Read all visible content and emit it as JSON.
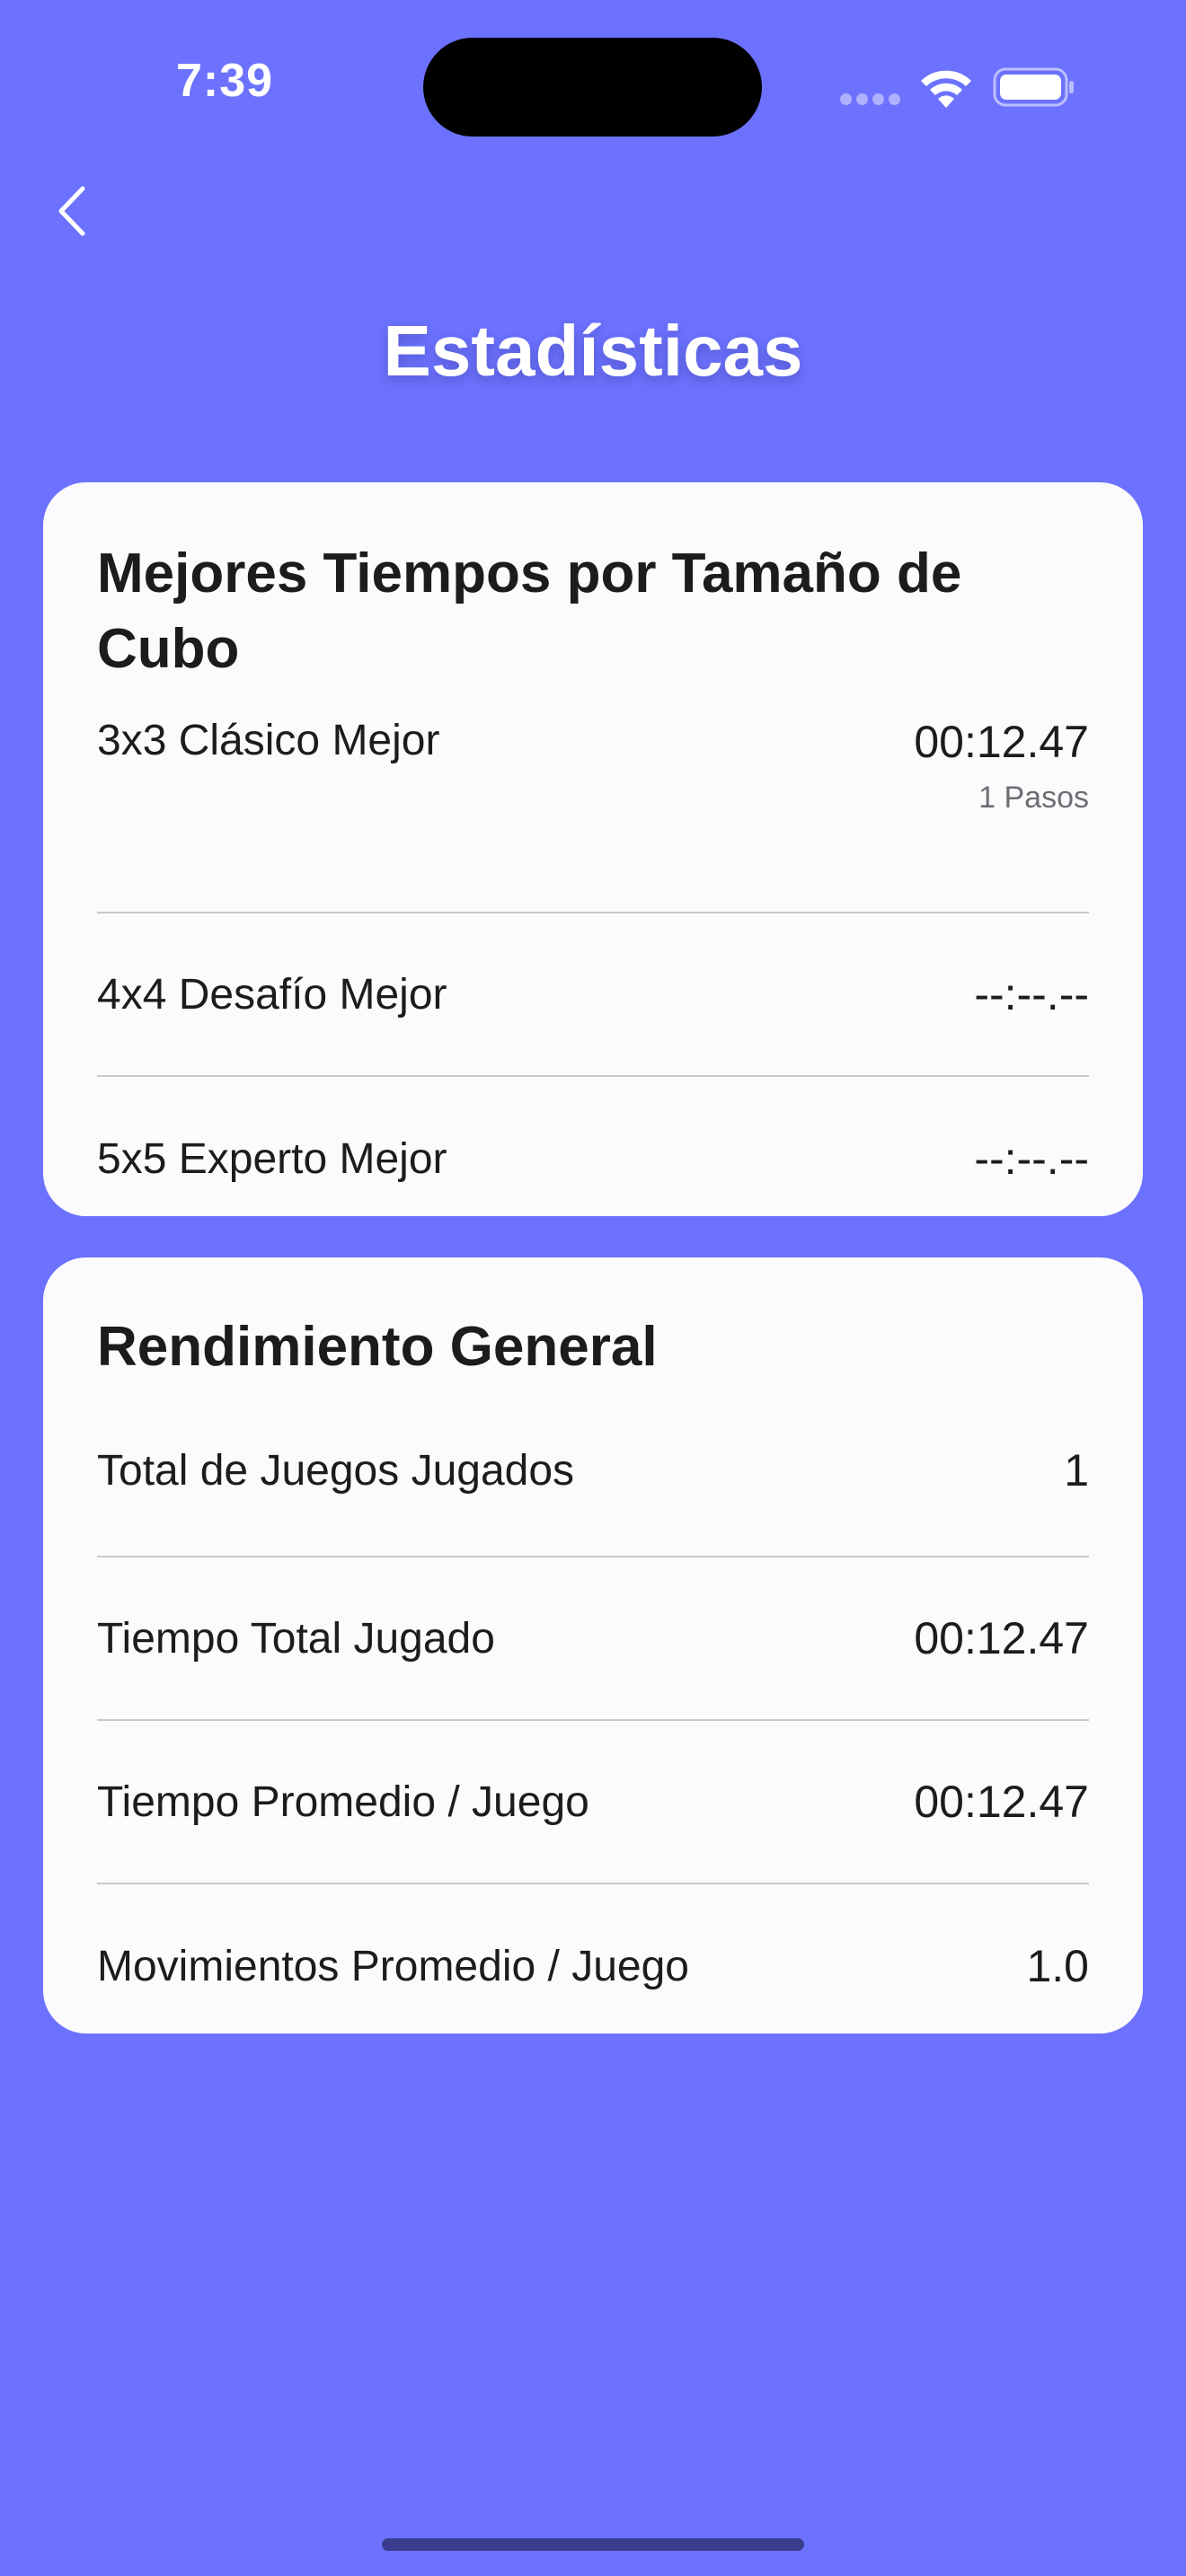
{
  "status_bar": {
    "time": "7:39"
  },
  "header": {
    "title": "Estadísticas"
  },
  "best_times": {
    "title": "Mejores Tiempos por Tamaño de Cubo",
    "rows": [
      {
        "label": "3x3 Clásico Mejor",
        "value": "00:12.47",
        "steps": "1 Pasos"
      },
      {
        "label": "4x4 Desafío Mejor",
        "value": "--:--.--"
      },
      {
        "label": "5x5 Experto Mejor",
        "value": "--:--.--"
      }
    ]
  },
  "general": {
    "title": "Rendimiento General",
    "rows": [
      {
        "label": "Total de Juegos Jugados",
        "value": "1"
      },
      {
        "label": "Tiempo Total Jugado",
        "value": "00:12.47"
      },
      {
        "label": "Tiempo Promedio / Juego",
        "value": "00:12.47"
      },
      {
        "label": "Movimientos Promedio / Juego",
        "value": "1.0"
      }
    ]
  },
  "colors": {
    "background": "#6c72fe",
    "card": "#fbfbfd",
    "text": "#1c1c1e",
    "divider": "#c7c7cc"
  },
  "icons": {
    "back": "chevron-left-icon",
    "wifi": "wifi-icon",
    "battery": "battery-icon",
    "signal": "cellular-signal-icon"
  }
}
